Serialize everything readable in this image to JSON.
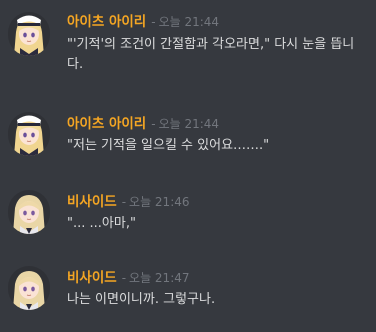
{
  "messages": [
    {
      "author": "아이츠 아이리",
      "separator": "-",
      "timestamp": "오늘 21:44",
      "text": "\"'기적'의 조건이 간절함과 각오라면,\" 다시 눈을 뜹니다."
    },
    {
      "author": "아이츠 아이리",
      "separator": "-",
      "timestamp": "오늘 21:44",
      "text": "\"저는 기적을 일으킬 수 있어요…….\""
    },
    {
      "author": "비사이드",
      "separator": "-",
      "timestamp": "오늘 21:46",
      "text": "\"... ...아마,\""
    },
    {
      "author": "비사이드",
      "separator": "-",
      "timestamp": "오늘 21:47",
      "text": "나는 이면이니까. 그렇구나."
    }
  ],
  "colors": {
    "background": "#36393f",
    "author": "#f5a623",
    "timestamp": "#72767d",
    "text": "#dcddde"
  }
}
